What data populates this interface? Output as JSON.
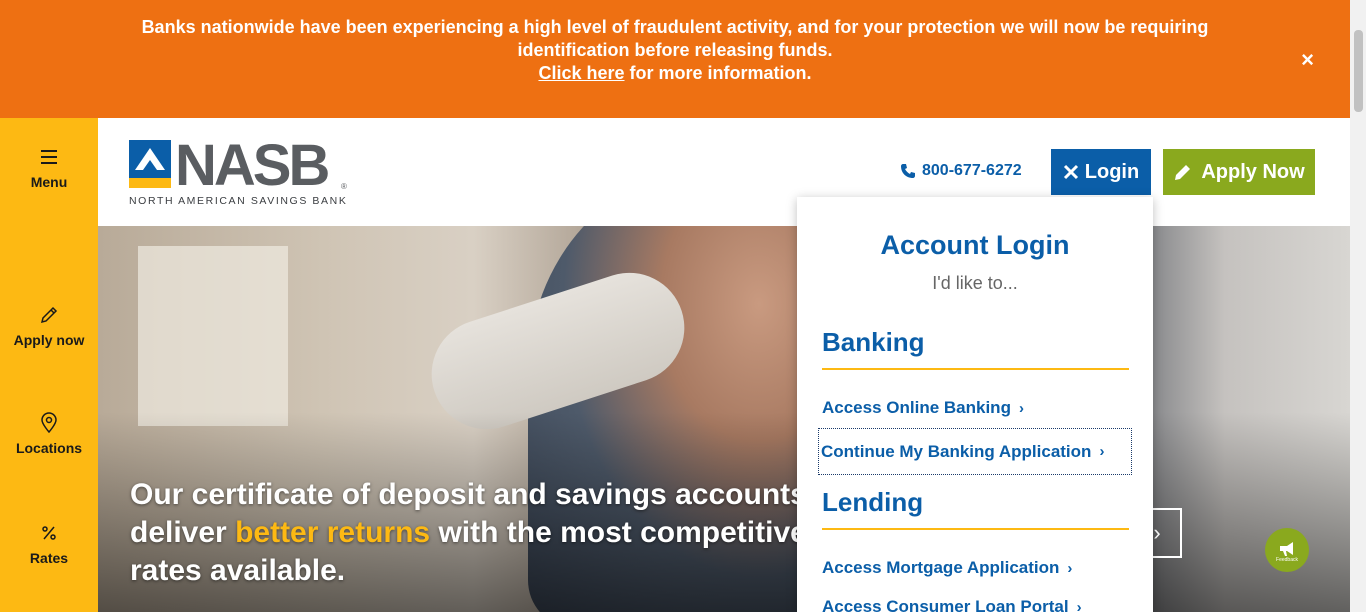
{
  "alert": {
    "line1": "Banks nationwide have been experiencing a high level of fraudulent activity, and for your protection we will now be requiring",
    "line2": "identification before releasing funds.",
    "link_text": "Click here",
    "line3_rest": " for more information.",
    "close": "×"
  },
  "sidebar": {
    "items": [
      {
        "label": "Menu",
        "icon": "hamburger-icon"
      },
      {
        "label": "Apply now",
        "icon": "pencil-icon"
      },
      {
        "label": "Locations",
        "icon": "map-pin-icon"
      },
      {
        "label": "Rates",
        "icon": "percent-icon"
      }
    ]
  },
  "header": {
    "logo_word": "NASB",
    "logo_reg": "®",
    "logo_sub": "NORTH AMERICAN SAVINGS BANK",
    "phone": "800-677-6272",
    "login_label": "Login",
    "apply_label": "Apply Now"
  },
  "hero": {
    "text_part1": "Our certificate of deposit and savings accounts",
    "text_part2_pre": "deliver ",
    "text_highlight": "better returns",
    "text_part2_post": " with the most competitive",
    "text_part3": "rates available.",
    "next": "›"
  },
  "login_dropdown": {
    "title": "Account Login",
    "subtitle": "I'd like to...",
    "banking_heading": "Banking",
    "banking_links": [
      "Access Online Banking",
      "Continue My Banking Application"
    ],
    "lending_heading": "Lending",
    "lending_links": [
      "Access Mortgage Application",
      "Access Consumer Loan Portal"
    ],
    "chevron": "›"
  },
  "feedback": {
    "label": "Feedback"
  },
  "colors": {
    "alert_orange": "#ee7012",
    "brand_blue": "#0b5ea8",
    "brand_yellow": "#fdb913",
    "apply_green": "#8aa91e"
  }
}
